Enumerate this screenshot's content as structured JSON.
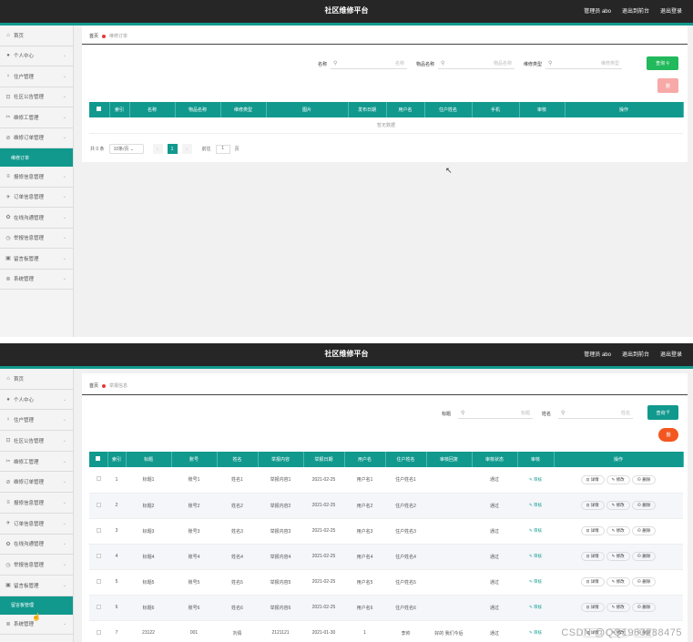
{
  "app": {
    "title": "社区维修平台",
    "nav": [
      "管理员 abo",
      "退出到前台",
      "退出登录"
    ]
  },
  "sidebar": {
    "items": [
      {
        "icon": "home-icon",
        "glyph": "⌂",
        "label": "首页",
        "chevron": false
      },
      {
        "icon": "user-icon",
        "glyph": "●",
        "label": "个人中心",
        "chevron": true
      },
      {
        "icon": "resident-icon",
        "glyph": "♀",
        "label": "住户管理",
        "chevron": true
      },
      {
        "icon": "notice-icon",
        "glyph": "⊡",
        "label": "社区公告管理",
        "chevron": true
      },
      {
        "icon": "worker-icon",
        "glyph": "✂",
        "label": "维修工管理",
        "chevron": true
      },
      {
        "icon": "order-icon",
        "glyph": "⊘",
        "label": "维修订单管理",
        "chevron": true
      },
      {
        "icon": "report-icon",
        "glyph": "≡",
        "label": "报修信息管理",
        "chevron": true
      },
      {
        "icon": "send-icon",
        "glyph": "✈",
        "label": "订单信息管理",
        "chevron": true
      },
      {
        "icon": "chat-icon",
        "glyph": "✿",
        "label": "在线沟通管理",
        "chevron": true
      },
      {
        "icon": "clock-icon",
        "glyph": "◷",
        "label": "举报信息管理",
        "chevron": true
      },
      {
        "icon": "lock-icon",
        "glyph": "▣",
        "label": "留言板管理",
        "chevron": true
      },
      {
        "icon": "list-icon",
        "glyph": "≣",
        "label": "系统管理",
        "chevron": true
      }
    ]
  },
  "screen1": {
    "breadcrumb": {
      "home": "首页",
      "current": "维修订单"
    },
    "active_submenu": "维修订单",
    "search": [
      {
        "label": "名称",
        "placeholder": "名称"
      },
      {
        "label": "物品名称",
        "placeholder": "物品名称"
      },
      {
        "label": "维修类型",
        "placeholder": "维修类型"
      }
    ],
    "query_button": "查询",
    "delete_button": "删",
    "columns": [
      "索引",
      "名称",
      "物品名称",
      "维修类型",
      "图片",
      "发布日期",
      "用户名",
      "住户姓名",
      "手机",
      "审核",
      "操作"
    ],
    "empty_text": "暂无数据",
    "pager": {
      "total": "共 0 条",
      "page_size": "10条/页",
      "page": "1",
      "goto": "前往",
      "goto_value": "1",
      "page_suffix": "页"
    }
  },
  "screen2": {
    "breadcrumb": {
      "home": "首页",
      "current": "举报信息"
    },
    "active_submenu": "留言板管理",
    "search": [
      {
        "label": "标题",
        "placeholder": "标题"
      },
      {
        "label": "姓名",
        "placeholder": "姓名"
      }
    ],
    "query_button": "查询",
    "delete_button": "删",
    "columns": [
      "索引",
      "标题",
      "账号",
      "姓名",
      "举报内容",
      "举报日期",
      "用户名",
      "住户姓名",
      "审核回复",
      "审核状态",
      "审核",
      "操作"
    ],
    "rows": [
      [
        "1",
        "标题1",
        "账号1",
        "姓名1",
        "举报内容1",
        "2021-02-25",
        "用户名1",
        "住户姓名1",
        "",
        "通过"
      ],
      [
        "2",
        "标题2",
        "账号2",
        "姓名2",
        "举报内容2",
        "2021-02-25",
        "用户名2",
        "住户姓名2",
        "",
        "通过"
      ],
      [
        "3",
        "标题3",
        "账号3",
        "姓名3",
        "举报内容3",
        "2021-02-25",
        "用户名3",
        "住户姓名3",
        "",
        "通过"
      ],
      [
        "4",
        "标题4",
        "账号4",
        "姓名4",
        "举报内容4",
        "2021-02-25",
        "用户名4",
        "住户姓名4",
        "",
        "通过"
      ],
      [
        "5",
        "标题5",
        "账号5",
        "姓名5",
        "举报内容5",
        "2021-02-25",
        "用户名5",
        "住户姓名5",
        "",
        "通过"
      ],
      [
        "6",
        "标题6",
        "账号6",
        "姓名6",
        "举报内容6",
        "2021-02-25",
        "用户名6",
        "住户姓名6",
        "",
        "通过"
      ],
      [
        "7",
        "23122",
        "001",
        "刘倩",
        "2121121",
        "2021-01-30",
        "1",
        "李帅",
        "好的 我们今后",
        "通过"
      ]
    ],
    "review_label": "审核",
    "ops": [
      "详情",
      "修改",
      "删除"
    ]
  },
  "watermark": "CSDN @QQ1963288475",
  "colors": {
    "topbar": "#262626",
    "accent": "#11998e",
    "query": "#21b95b",
    "delete_disabled": "#f7a9a7",
    "delete_active": "#f3561f"
  }
}
